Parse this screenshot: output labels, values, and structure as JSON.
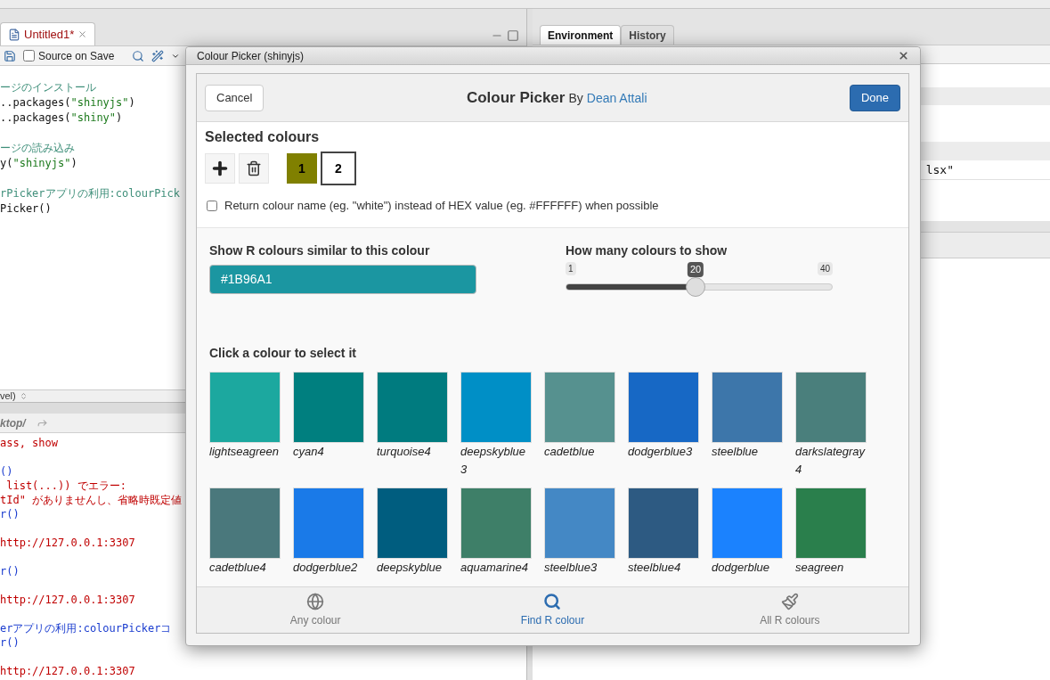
{
  "editor": {
    "tab": {
      "label": "Untitled1*",
      "selected": true
    },
    "source_on_save": {
      "label": "Source on Save",
      "checked": false
    },
    "blocks": [
      [
        [
          {
            "text": "ージのインストール",
            "kind": "comment"
          }
        ],
        [
          {
            "text": "..packages(",
            "kind": "code"
          },
          {
            "text": "\"shinyjs\"",
            "kind": "string"
          },
          {
            "text": ")",
            "kind": "code"
          }
        ],
        [
          {
            "text": "..packages(",
            "kind": "code"
          },
          {
            "text": "\"shiny\"",
            "kind": "string"
          },
          {
            "text": ")",
            "kind": "code"
          }
        ]
      ],
      [
        [
          {
            "text": "ージの読み込み",
            "kind": "comment"
          }
        ],
        [
          {
            "text": "y(",
            "kind": "code"
          },
          {
            "text": "\"shinyjs\"",
            "kind": "string"
          },
          {
            "text": ")",
            "kind": "code"
          }
        ]
      ],
      [
        [
          {
            "text": "rPickerアプリの利用:colourPick",
            "kind": "comment"
          }
        ],
        [
          {
            "text": "Picker()",
            "kind": "code"
          }
        ]
      ]
    ],
    "status": "vel)"
  },
  "console": {
    "path": "ktop/",
    "blocks": [
      [
        {
          "text": "ass, show",
          "kind": "error"
        }
      ],
      [
        {
          "text": "()",
          "kind": "command"
        },
        {
          "text": " list(...)) でエラー:",
          "kind": "error"
        },
        {
          "text": "tId\" がありませんし、省略時既定値",
          "kind": "error"
        },
        {
          "text": "r()",
          "kind": "command"
        }
      ],
      [
        {
          "text": "http://127.0.0.1:3307",
          "kind": "error"
        }
      ],
      [
        {
          "text": "r()",
          "kind": "command"
        }
      ],
      [
        {
          "text": "http://127.0.0.1:3307",
          "kind": "error"
        }
      ],
      [
        {
          "text": "erアプリの利用:colourPickerコ",
          "kind": "command"
        },
        {
          "text": "r()",
          "kind": "command"
        }
      ],
      [
        {
          "text": "http://127.0.0.1:3307",
          "kind": "error"
        }
      ]
    ]
  },
  "environment": {
    "tabs": [
      {
        "label": "Environment",
        "selected": true
      },
      {
        "label": "History",
        "selected": false
      }
    ],
    "cell": "lsx\""
  },
  "dialog": {
    "title": "Colour Picker (shinyjs)",
    "header": {
      "cancel": "Cancel",
      "title": "Colour Picker",
      "by": "By",
      "author": "Dean Attali",
      "done": "Done"
    },
    "selected_heading": "Selected colours",
    "selected_colours": [
      {
        "label": "1",
        "color": "#808000",
        "selected": false
      },
      {
        "label": "2",
        "color": "#ffffff",
        "selected": true
      }
    ],
    "return_name": {
      "label": "Return colour name (eg. \"white\") instead of HEX value (eg. #FFFFFF) when possible",
      "checked": false
    },
    "similar_label": "Show R colours similar to this colour",
    "similar_value": "#1B96A1",
    "count_label": "How many colours to show",
    "slider": {
      "min_label": "1",
      "value_label": "20",
      "max_label": "40",
      "level": 0.487
    },
    "grid_label": "Click a colour to select it",
    "swatches": [
      {
        "name": "lightseagreen",
        "color": "#1ca89f"
      },
      {
        "name": "cyan4",
        "color": "#007f7f"
      },
      {
        "name": "turquoise4",
        "color": "#007b7f"
      },
      {
        "name": "deepskyblue3",
        "color": "#008fc6"
      },
      {
        "name": "cadetblue",
        "color": "#56918f"
      },
      {
        "name": "dodgerblue3",
        "color": "#1768c5"
      },
      {
        "name": "steelblue",
        "color": "#3d76aa"
      },
      {
        "name": "darkslategray4",
        "color": "#4a7f7c"
      },
      {
        "name": "cadetblue4",
        "color": "#4a787c"
      },
      {
        "name": "dodgerblue2",
        "color": "#1a7ae8"
      },
      {
        "name": "deepskyblue",
        "color": "#005d7f"
      },
      {
        "name": "aquamarine4",
        "color": "#3e7f68"
      },
      {
        "name": "steelblue3",
        "color": "#4488c5"
      },
      {
        "name": "steelblue4",
        "color": "#2d5a82"
      },
      {
        "name": "dodgerblue",
        "color": "#1b82fe"
      },
      {
        "name": "seagreen",
        "color": "#2a7f4c"
      }
    ],
    "footer_tabs": [
      {
        "label": "Any colour",
        "kind": "globe",
        "selected": false
      },
      {
        "label": "Find R colour",
        "kind": "search",
        "selected": true
      },
      {
        "label": "All R colours",
        "kind": "brush",
        "selected": false
      }
    ]
  }
}
